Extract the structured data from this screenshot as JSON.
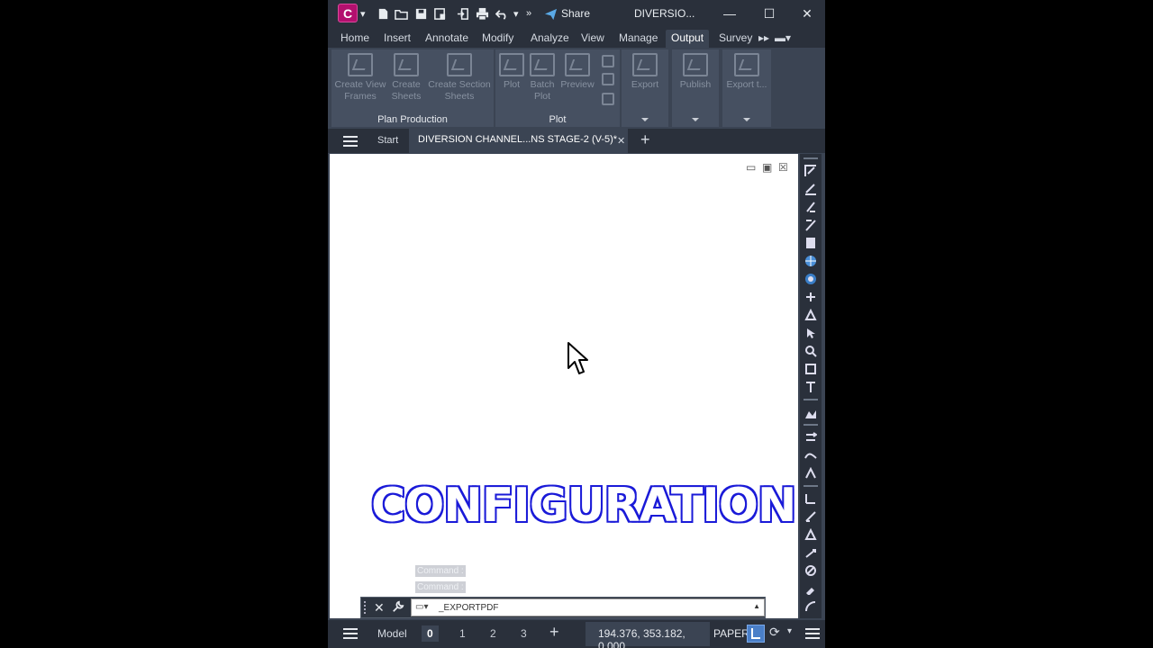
{
  "titlebar": {
    "logo_letter": "C",
    "share_label": "Share",
    "window_title": "DIVERSIO...",
    "minimize": "—",
    "maximize": "☐",
    "close": "✕"
  },
  "ribbon_tabs": [
    "Home",
    "Insert",
    "Annotate",
    "Modify",
    "Analyze",
    "View",
    "Manage",
    "Output",
    "Survey"
  ],
  "active_tab": "Output",
  "ribbon": {
    "plan_production": {
      "title": "Plan Production",
      "buttons": [
        {
          "label": "Create View Frames"
        },
        {
          "label": "Create Sheets"
        },
        {
          "label": "Create Section Sheets"
        }
      ]
    },
    "plot": {
      "title": "Plot",
      "buttons": [
        {
          "label": "Plot"
        },
        {
          "label": "Batch Plot"
        },
        {
          "label": "Preview"
        }
      ]
    },
    "export": {
      "label": "Export"
    },
    "publish": {
      "label": "Publish"
    },
    "export_to": {
      "label": "Export t..."
    }
  },
  "filetabs": {
    "start": "Start",
    "active": "DIVERSION CHANNEL...NS STAGE-2 (V-5)*",
    "close": "✕",
    "add": "+"
  },
  "canvas": {
    "banner": "CONFIGURATION",
    "history": [
      "Command :",
      "Command :"
    ]
  },
  "command_line": {
    "value": "_EXPORTPDF",
    "close_glyph": "✕",
    "wrench_glyph": "🔧",
    "prompt_glyph": "▾"
  },
  "status_bar": {
    "model": "Model",
    "layouts": [
      "0",
      "1",
      "2",
      "3"
    ],
    "active_layout": "0",
    "add": "+",
    "coordinates": "194.376, 353.182, 0.000",
    "space": "PAPER"
  },
  "colors": {
    "background": "#000000",
    "app_dark": "#2a303b",
    "app_panel": "#3b4453",
    "logo": "#b3106e",
    "banner_outline": "#1a1ad8"
  },
  "icons": {
    "cursor": "arrow-pointer-icon",
    "new": "new-file-icon",
    "open": "open-folder-icon",
    "save": "save-icon",
    "save_as": "save-as-icon",
    "import": "import-icon",
    "print": "print-icon",
    "undo": "undo-icon",
    "share": "paper-plane-icon"
  }
}
